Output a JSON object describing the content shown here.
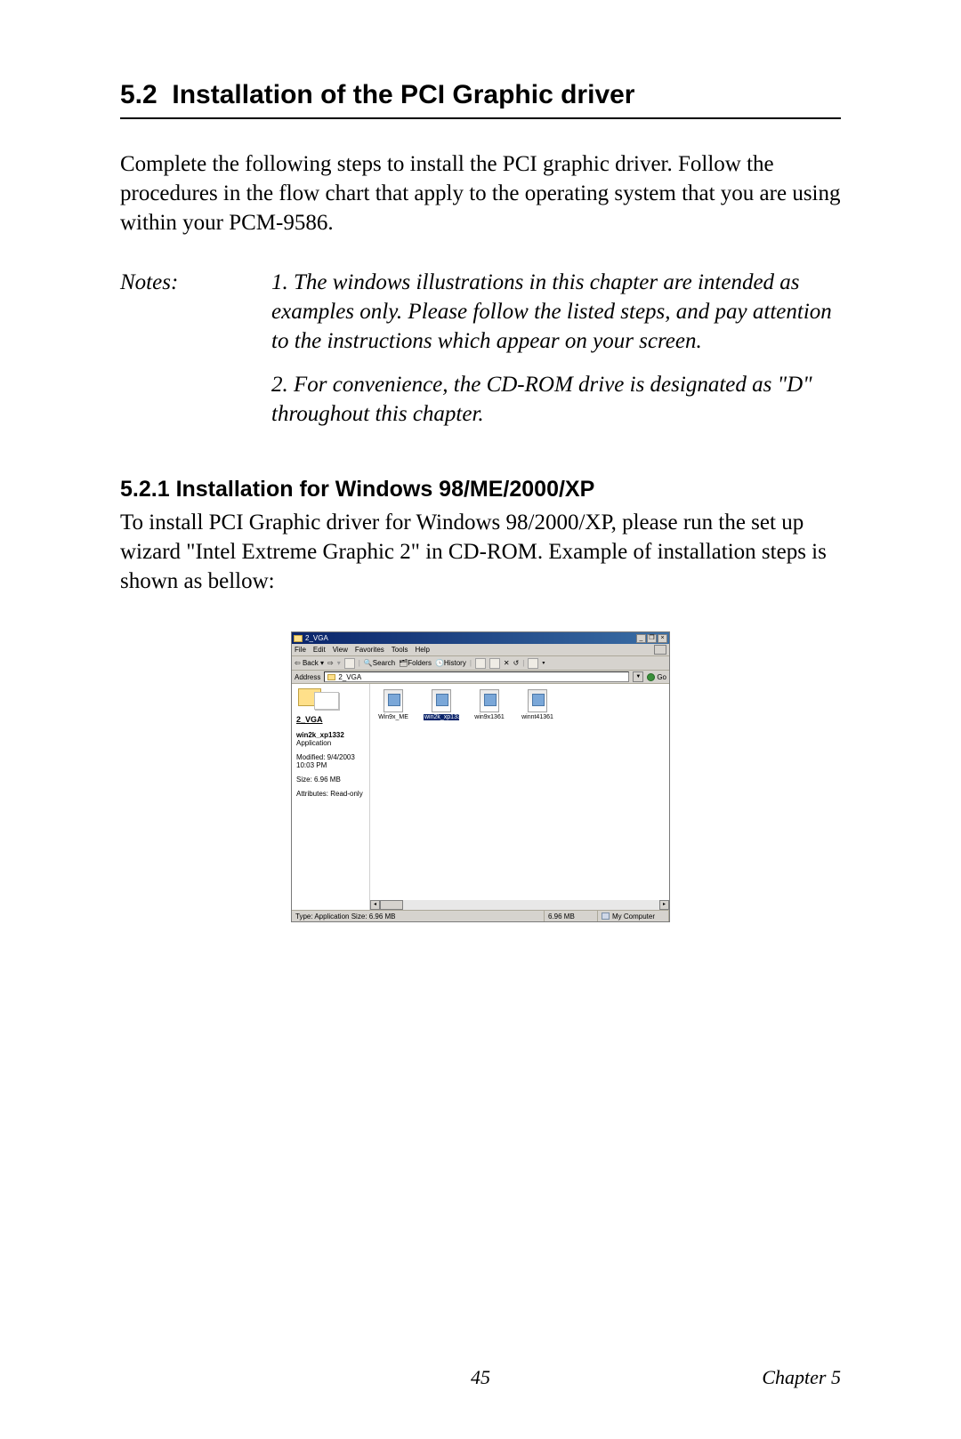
{
  "section": {
    "number": "5.2",
    "title": "Installation of the PCI Graphic driver",
    "intro": "Complete the following steps to install the PCI graphic driver. Follow the procedures in the flow chart that apply to the operating system that you are using within your PCM-9586."
  },
  "notes": {
    "label": "Notes:",
    "items": [
      "1.  The windows illustrations in this chapter are intended as examples only. Please follow the listed steps, and pay attention to the instructions which appear on your screen.",
      "2.  For convenience, the CD-ROM drive is designated as \"D\" throughout this chapter."
    ]
  },
  "subsection": {
    "number": "5.2.1",
    "title": "Installation for Windows 98/ME/2000/XP",
    "body": "To install PCI Graphic driver for Windows 98/2000/XP, please run the set up wizard \"Intel Extreme Graphic 2\"  in CD-ROM.  Example of installation steps is shown as bellow:"
  },
  "explorer": {
    "title": "2_VGA",
    "menu": [
      "File",
      "Edit",
      "View",
      "Favorites",
      "Tools",
      "Help"
    ],
    "toolbar": {
      "back": "Back",
      "search": "Search",
      "folders": "Folders",
      "history": "History"
    },
    "address_label": "Address",
    "address_value": "2_VGA",
    "go": "Go",
    "left": {
      "folder_title": "2_VGA",
      "sel_name": "win2k_xp1332",
      "sel_type": "Application",
      "modified": "Modified: 9/4/2003 10:03 PM",
      "size": "Size: 6.96 MB",
      "attrs": "Attributes: Read-only"
    },
    "files": [
      {
        "label": "Win9x_ME"
      },
      {
        "label": "win2k_xp1332",
        "selected": true
      },
      {
        "label": "win9x1361"
      },
      {
        "label": "winnt41361"
      }
    ],
    "status": {
      "type": "Type: Application Size: 6.96 MB",
      "size": "6.96 MB",
      "location": "My Computer"
    }
  },
  "footer": {
    "page": "45",
    "chapter": "Chapter 5"
  }
}
